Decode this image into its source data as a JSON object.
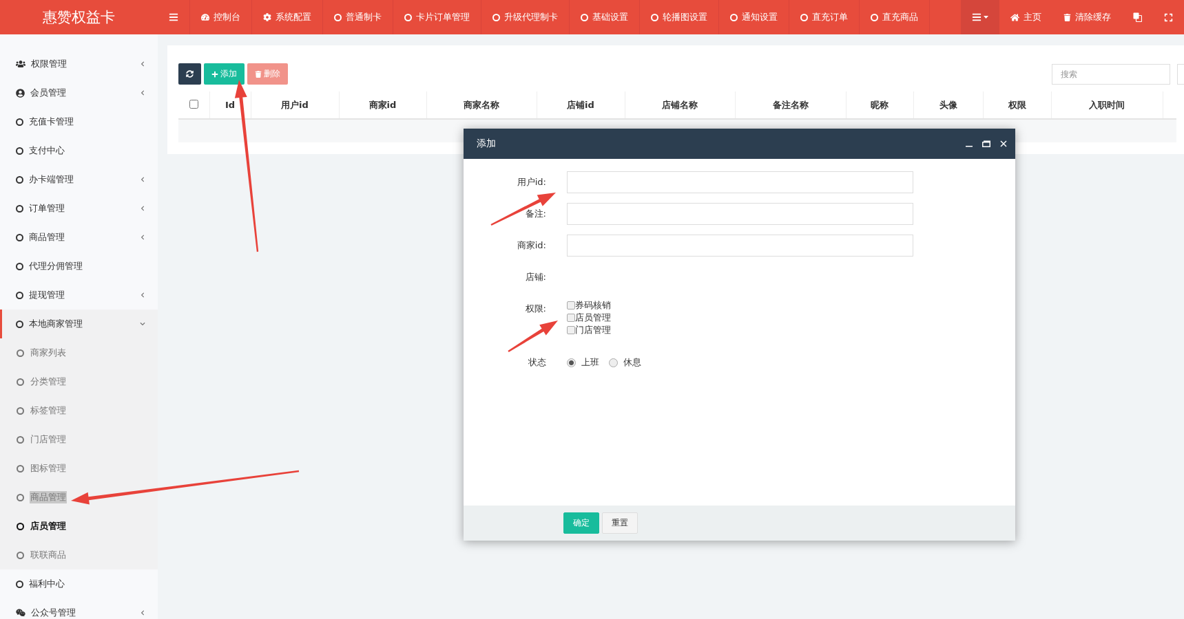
{
  "topbar": {
    "logo": "惠赞权益卡",
    "nav": [
      {
        "kind": "menu"
      },
      {
        "kind": "dashboard",
        "label": "控制台"
      },
      {
        "kind": "gear",
        "label": "系统配置"
      },
      {
        "kind": "circle",
        "label": "普通制卡"
      },
      {
        "kind": "circle",
        "label": "卡片订单管理"
      },
      {
        "kind": "circle",
        "label": "升级代理制卡"
      },
      {
        "kind": "circle",
        "label": "基础设置"
      },
      {
        "kind": "circle",
        "label": "轮播图设置"
      },
      {
        "kind": "circle",
        "label": "通知设置"
      },
      {
        "kind": "circle",
        "label": "直充订单"
      },
      {
        "kind": "circle",
        "label": "直充商品"
      }
    ],
    "right": [
      {
        "kind": "list-dropdown",
        "selected": true
      },
      {
        "kind": "home",
        "label": "主页",
        "selected": false
      },
      {
        "kind": "trash",
        "label": "清除缓存",
        "selected": false
      },
      {
        "kind": "translate",
        "selected": false
      },
      {
        "kind": "fullscreen",
        "selected": false
      }
    ]
  },
  "sidebar": {
    "items": [
      {
        "kind": "users",
        "label": "权限管理",
        "caret": true,
        "expanded": false
      },
      {
        "kind": "user",
        "label": "会员管理",
        "caret": true,
        "expanded": false
      },
      {
        "kind": "circle",
        "label": "充值卡管理",
        "caret": false,
        "expanded": false
      },
      {
        "kind": "circle",
        "label": "支付中心",
        "caret": false,
        "expanded": false
      },
      {
        "kind": "circle",
        "label": "办卡端管理",
        "caret": true,
        "expanded": false
      },
      {
        "kind": "circle",
        "label": "订单管理",
        "caret": true,
        "expanded": false
      },
      {
        "kind": "circle",
        "label": "商品管理",
        "caret": true,
        "expanded": false
      },
      {
        "kind": "circle",
        "label": "代理分佣管理",
        "caret": false,
        "expanded": false
      },
      {
        "kind": "circle",
        "label": "提现管理",
        "caret": true,
        "expanded": false
      },
      {
        "kind": "circle",
        "label": "本地商家管理",
        "caret": true,
        "expanded": true,
        "children": [
          {
            "label": "商家列表",
            "selected": false,
            "highlighted": false
          },
          {
            "label": "分类管理",
            "selected": false,
            "highlighted": false
          },
          {
            "label": "标签管理",
            "selected": false,
            "highlighted": false
          },
          {
            "label": "门店管理",
            "selected": false,
            "highlighted": false
          },
          {
            "label": "图标管理",
            "selected": false,
            "highlighted": false
          },
          {
            "label": "商品管理",
            "selected": false,
            "highlighted": true
          },
          {
            "label": "店员管理",
            "selected": true,
            "highlighted": false
          },
          {
            "label": "联联商品",
            "selected": false,
            "highlighted": false
          }
        ]
      },
      {
        "kind": "circle",
        "label": "福利中心",
        "caret": false,
        "expanded": false
      },
      {
        "kind": "wechat",
        "label": "公众号管理",
        "caret": true,
        "expanded": false
      }
    ]
  },
  "toolbar": {
    "buttons": [
      {
        "kind": "refresh"
      },
      {
        "kind": "add",
        "label": "添加"
      },
      {
        "kind": "delete",
        "label": "删除",
        "disabled": true
      }
    ],
    "search": {
      "placeholder": "搜索"
    }
  },
  "table": {
    "select_all": {
      "checked": false
    },
    "columns": [
      "Id",
      "用户id",
      "商家id",
      "商家名称",
      "店铺id",
      "店铺名称",
      "备注名称",
      "昵称",
      "头像",
      "权限",
      "入职时间"
    ]
  },
  "dialog": {
    "title": "添加",
    "fields": [
      {
        "kind": "input",
        "label": "用户id:"
      },
      {
        "kind": "input",
        "label": "备注:"
      },
      {
        "kind": "input",
        "label": "商家id:"
      },
      {
        "kind": "text",
        "label": "店铺:"
      },
      {
        "kind": "checkboxes",
        "label": "权限:",
        "options": [
          {
            "label": "券码核销",
            "checked": false
          },
          {
            "label": "店员管理",
            "checked": false
          },
          {
            "label": "门店管理",
            "checked": false
          }
        ]
      },
      {
        "kind": "radios",
        "label": "状态",
        "options": [
          {
            "label": "上班",
            "selected": true
          },
          {
            "label": "休息",
            "selected": false
          }
        ]
      }
    ],
    "buttons": [
      {
        "kind": "primary",
        "label": "确定"
      },
      {
        "kind": "default",
        "label": "重置"
      }
    ]
  }
}
